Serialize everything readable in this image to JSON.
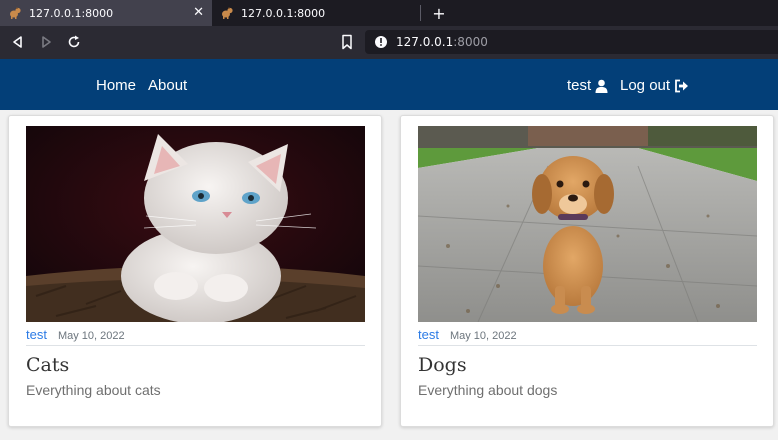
{
  "browser": {
    "tabs": [
      {
        "title": "127.0.0.1:8000",
        "active": true,
        "favicon": "dog-favicon"
      },
      {
        "title": "127.0.0.1:8000",
        "active": false,
        "favicon": "dog-favicon"
      }
    ],
    "new_tab_icon": "plus-icon",
    "url_host": "127.0.0.1",
    "url_port": ":8000"
  },
  "header": {
    "nav_home": "Home",
    "nav_about": "About",
    "user_label": "test",
    "logout_label": "Log out",
    "bg_color": "#033f78"
  },
  "posts": [
    {
      "author": "test",
      "date": "May 10, 2022",
      "title": "Cats",
      "description": "Everything about cats",
      "image": "white-kitten-photo"
    },
    {
      "author": "test",
      "date": "May 10, 2022",
      "title": "Dogs",
      "description": "Everything about dogs",
      "image": "golden-puppy-photo"
    }
  ],
  "colors": {
    "author_link": "#2c7be5"
  }
}
